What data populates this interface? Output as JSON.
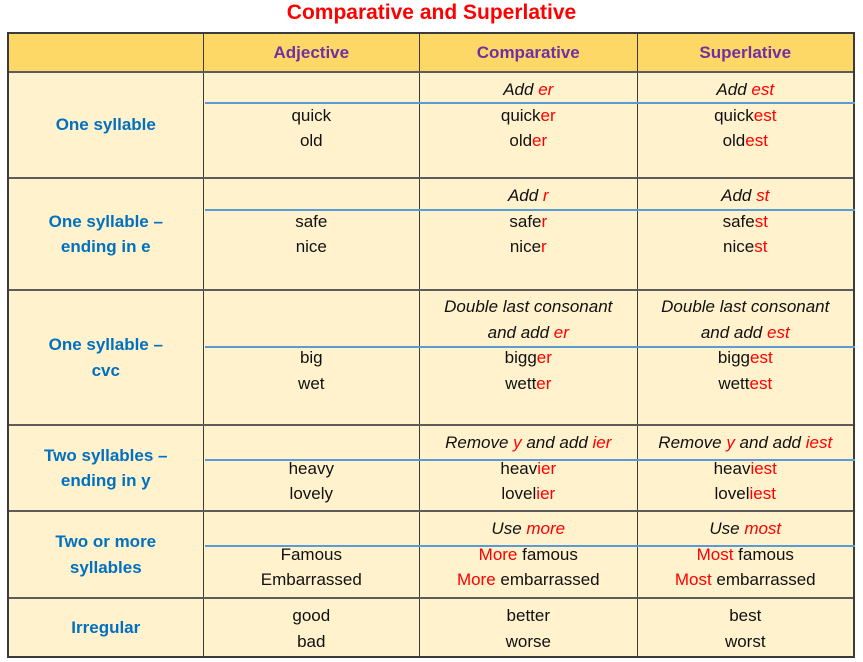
{
  "title": "Comparative and Superlative",
  "headers": [
    "",
    "Adjective",
    "Comparative",
    "Superlative"
  ],
  "colors": {
    "title": "#ff0000",
    "header_bg": "#fdd867",
    "body_bg": "#fff2cc",
    "header_text": "#7030a0",
    "label_text": "#0070c0",
    "divider": "#5b9bd5",
    "suffix": "#ff0000"
  },
  "rows": [
    {
      "label": [
        "One syllable"
      ],
      "adjective": [
        "quick",
        "old"
      ],
      "comparative": {
        "rule": [
          [
            [
              "Add ",
              0
            ],
            [
              "er",
              1
            ]
          ]
        ],
        "words": [
          [
            [
              "quick",
              0
            ],
            [
              "er",
              1
            ]
          ],
          [
            [
              "old",
              0
            ],
            [
              "er",
              1
            ]
          ]
        ]
      },
      "superlative": {
        "rule": [
          [
            [
              "Add ",
              0
            ],
            [
              "est",
              1
            ]
          ]
        ],
        "words": [
          [
            [
              "quick",
              0
            ],
            [
              "est",
              1
            ]
          ],
          [
            [
              "old",
              0
            ],
            [
              "est",
              1
            ]
          ]
        ]
      }
    },
    {
      "label": [
        "One syllable –",
        "ending in e"
      ],
      "adjective": [
        "safe",
        "nice"
      ],
      "comparative": {
        "rule": [
          [
            [
              "Add ",
              0
            ],
            [
              "r",
              1
            ]
          ]
        ],
        "words": [
          [
            [
              "safe",
              0
            ],
            [
              "r",
              1
            ]
          ],
          [
            [
              "nice",
              0
            ],
            [
              "r",
              1
            ]
          ]
        ]
      },
      "superlative": {
        "rule": [
          [
            [
              "Add ",
              0
            ],
            [
              "st",
              1
            ]
          ]
        ],
        "words": [
          [
            [
              "safe",
              0
            ],
            [
              "st",
              1
            ]
          ],
          [
            [
              "nice",
              0
            ],
            [
              "st",
              1
            ]
          ]
        ]
      }
    },
    {
      "label": [
        "One syllable –",
        "cvc"
      ],
      "adjective": [
        "big",
        "wet"
      ],
      "comparative": {
        "rule": [
          [
            [
              "Double last consonant",
              0
            ]
          ],
          [
            [
              "and add ",
              0
            ],
            [
              "er",
              1
            ]
          ]
        ],
        "words": [
          [
            [
              "bigg",
              0
            ],
            [
              "er",
              1
            ]
          ],
          [
            [
              "wett",
              0
            ],
            [
              "er",
              1
            ]
          ]
        ]
      },
      "superlative": {
        "rule": [
          [
            [
              "Double last consonant",
              0
            ]
          ],
          [
            [
              "and add ",
              0
            ],
            [
              "est",
              1
            ]
          ]
        ],
        "words": [
          [
            [
              "bigg",
              0
            ],
            [
              "est",
              1
            ]
          ],
          [
            [
              "wett",
              0
            ],
            [
              "est",
              1
            ]
          ]
        ]
      }
    },
    {
      "label": [
        "Two syllables –",
        "ending in y"
      ],
      "adjective": [
        "heavy",
        "lovely"
      ],
      "comparative": {
        "rule": [
          [
            [
              "Remove ",
              0
            ],
            [
              "y",
              1
            ],
            [
              " and add ",
              0
            ],
            [
              "ier",
              1
            ]
          ]
        ],
        "words": [
          [
            [
              "heav",
              0
            ],
            [
              "ier",
              1
            ]
          ],
          [
            [
              "lovel",
              0
            ],
            [
              "ier",
              1
            ]
          ]
        ]
      },
      "superlative": {
        "rule": [
          [
            [
              "Remove ",
              0
            ],
            [
              "y",
              1
            ],
            [
              " and add ",
              0
            ],
            [
              "iest",
              1
            ]
          ]
        ],
        "words": [
          [
            [
              "heav",
              0
            ],
            [
              "iest",
              1
            ]
          ],
          [
            [
              "lovel",
              0
            ],
            [
              "iest",
              1
            ]
          ]
        ]
      }
    },
    {
      "label": [
        "Two or more",
        "syllables"
      ],
      "adjective": [
        "Famous",
        "Embarrassed"
      ],
      "comparative": {
        "rule": [
          [
            [
              "Use ",
              0
            ],
            [
              "more",
              1
            ]
          ]
        ],
        "words": [
          [
            [
              "More",
              1
            ],
            [
              " famous",
              0
            ]
          ],
          [
            [
              "More",
              1
            ],
            [
              " embarrassed",
              0
            ]
          ]
        ]
      },
      "superlative": {
        "rule": [
          [
            [
              "Use ",
              0
            ],
            [
              "most",
              1
            ]
          ]
        ],
        "words": [
          [
            [
              "Most",
              1
            ],
            [
              " famous",
              0
            ]
          ],
          [
            [
              "Most",
              1
            ],
            [
              " embarrassed",
              0
            ]
          ]
        ]
      }
    },
    {
      "label": [
        "Irregular"
      ],
      "adjective": [
        "good",
        "bad"
      ],
      "comparative": {
        "rule": [],
        "words": [
          [
            [
              "better",
              0
            ]
          ],
          [
            [
              "worse",
              0
            ]
          ]
        ]
      },
      "superlative": {
        "rule": [],
        "words": [
          [
            [
              "best",
              0
            ]
          ],
          [
            [
              "worst",
              0
            ]
          ]
        ]
      }
    }
  ]
}
